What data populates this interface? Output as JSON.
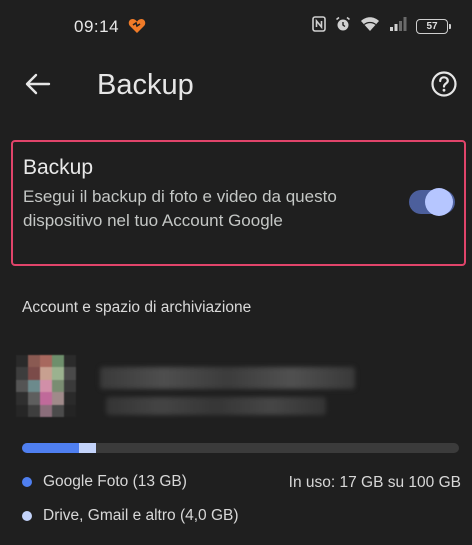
{
  "status_bar": {
    "time": "09:14",
    "notification_icon": "app-heart-icon",
    "icons": [
      "nfc-icon",
      "alarm-icon",
      "wifi-icon",
      "signal-icon"
    ],
    "battery_level": "57"
  },
  "app_bar": {
    "back_icon": "arrow-back-icon",
    "title": "Backup",
    "help_icon": "help-circle-icon"
  },
  "backup_setting": {
    "title": "Backup",
    "description": "Esegui il backup di foto e video da questo dispositivo nel tuo Account Google",
    "enabled": true,
    "highlight_color": "#e0446a",
    "toggle_track_color": "#4c5f9c",
    "toggle_thumb_color": "#b6c6ff"
  },
  "storage": {
    "section_title": "Account e spazio di archiviazione",
    "account_redacted": true,
    "used_fraction": 0.17,
    "google_photos_fraction": 0.13,
    "other_fraction": 0.04,
    "legend": [
      {
        "label": "Google Foto (13 GB)",
        "color": "#4f7ff0"
      },
      {
        "label": "Drive, Gmail e altro (4,0 GB)",
        "color": "#c3d3fa"
      }
    ],
    "usage_text": "In uso: 17 GB su 100 GB"
  }
}
